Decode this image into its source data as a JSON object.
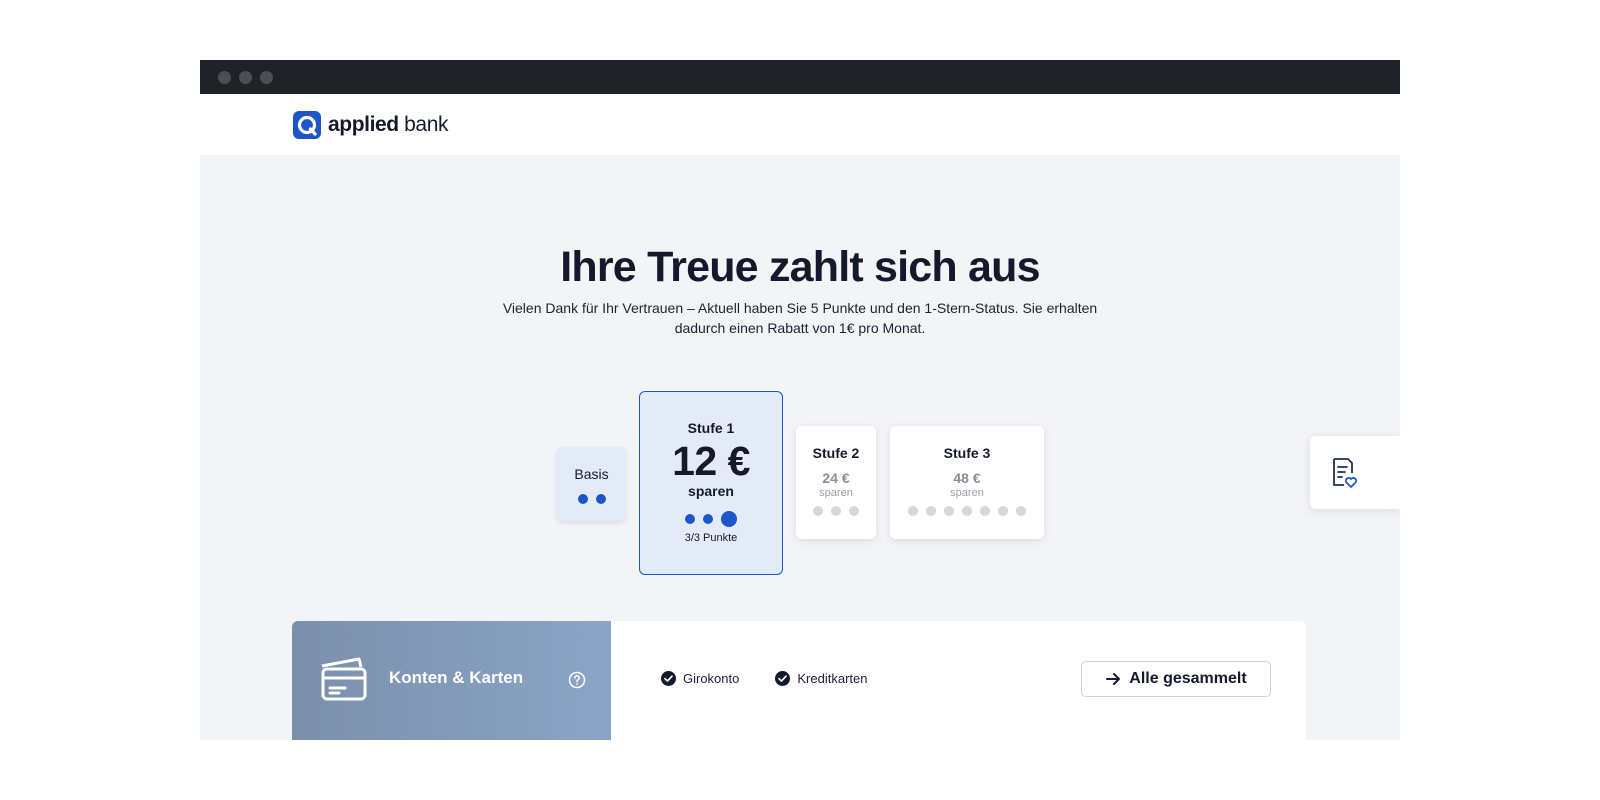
{
  "brand": {
    "name_bold": "applied",
    "name_regular": "bank"
  },
  "hero": {
    "title": "Ihre Treue zahlt sich aus",
    "subtitle": "Vielen Dank für Ihr Vertrauen – Aktuell haben Sie 5 Punkte und den 1-Stern-Status. Sie erhalten dadurch einen Rabatt von 1€ pro Monat."
  },
  "tiers": [
    {
      "name": "Basis",
      "points_total": 2,
      "points_filled": 2
    },
    {
      "name": "Stufe 1",
      "amount": "12 €",
      "save_label": "sparen",
      "points_total": 3,
      "points_filled": 3,
      "points_text": "3/3 Punkte",
      "active": true
    },
    {
      "name": "Stufe 2",
      "amount": "24 €",
      "save_label": "sparen",
      "points_total": 3,
      "points_filled": 0
    },
    {
      "name": "Stufe 3",
      "amount": "48 €",
      "save_label": "sparen",
      "points_total": 7,
      "points_filled": 0
    }
  ],
  "accounts": {
    "title": "Konten & Karten",
    "items": [
      "Girokonto",
      "Kreditkarten"
    ],
    "button_label": "Alle gesammelt"
  },
  "icons": {
    "logo": "applied-bank-logo-icon",
    "side_tab": "document-heart-icon",
    "card": "credit-card-icon",
    "help": "question-circle-icon",
    "check": "check-circle-icon",
    "arrow": "arrow-right-icon"
  },
  "colors": {
    "accent": "#1c56c9",
    "dark": "#141a2b",
    "window_bar": "#1f2227",
    "background": "#f3f4f6"
  }
}
